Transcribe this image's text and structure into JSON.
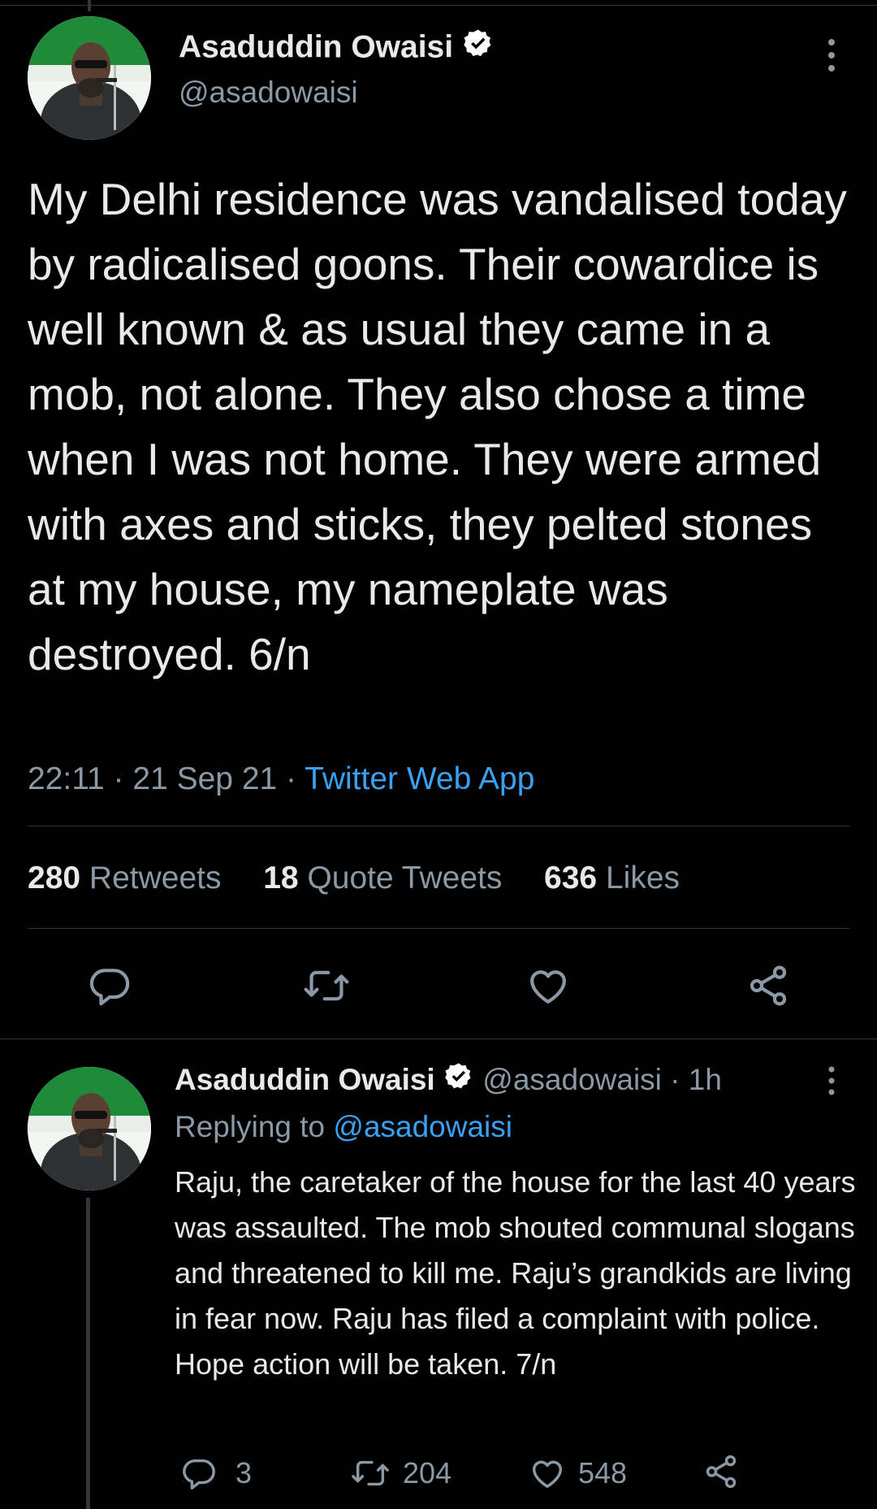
{
  "main_tweet": {
    "author_name": "Asaduddin Owaisi",
    "handle": "@asadowaisi",
    "text": "My Delhi residence was vandalised today by radicalised goons. Their cowardice is well known & as usual they came in a mob, not alone. They also chose a time when I was not home. They were armed with axes and sticks, they pelted stones at my house, my nameplate was destroyed. 6/n",
    "time": "22:11",
    "date": "21 Sep 21",
    "source": "Twitter Web App",
    "stats": {
      "retweets_count": "280",
      "retweets_label": "Retweets",
      "quotes_count": "18",
      "quotes_label": "Quote Tweets",
      "likes_count": "636",
      "likes_label": "Likes"
    },
    "actions": [
      "reply-icon",
      "retweet-icon",
      "like-icon",
      "share-icon"
    ]
  },
  "reply_tweet": {
    "author_name": "Asaduddin Owaisi",
    "handle": "@asadowaisi",
    "age": "1h",
    "replying_label": "Replying to",
    "replying_to": "@asadowaisi",
    "text": "Raju, the caretaker of the house for the last 40 years was assaulted. The mob shouted communal slogans and threatened to kill me. Raju’s grandkids are living in fear now. Raju has filed a complaint with police. Hope action will be taken. 7/n",
    "reply_count": "3",
    "retweet_count": "204",
    "like_count": "548"
  },
  "colors": {
    "background": "#000000",
    "text": "#e7e9ea",
    "secondary": "#8b98a5",
    "link": "#3aa0f2",
    "divider": "#2f3336"
  }
}
